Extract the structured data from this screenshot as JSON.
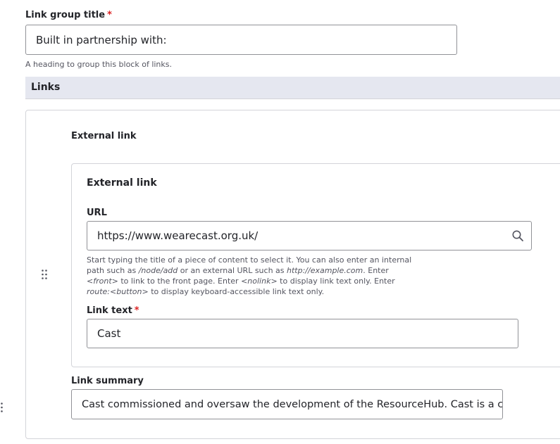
{
  "link_group": {
    "title_label": "Link group title",
    "required_mark": "*",
    "title_value": "Built in partnership with:",
    "title_description": "A heading to group this block of links."
  },
  "links_section": {
    "heading": "Links"
  },
  "external_link": {
    "outer_label": "External link",
    "fieldset_title": "External link",
    "url_label": "URL",
    "url_value": "https://www.wearecast.org.uk/",
    "url_description": {
      "t1": "Start typing the title of a piece of content to select it. You can also enter an internal path such as ",
      "e1": "/node/add",
      "t2": " or an external URL such as ",
      "e2": "http://example.com",
      "t3": ". Enter ",
      "e3": "<front>",
      "t4": " to link to the front page. Enter ",
      "e4": "<nolink>",
      "t5": " to display link text only. Enter ",
      "e5": "route:<button>",
      "t6": " to display keyboard-accessible link text only."
    },
    "link_text_label": "Link text",
    "link_text_value": "Cast"
  },
  "link_summary": {
    "label": "Link summary",
    "value": "Cast commissioned and oversaw the development of the ResourceHub. Cast is a charity or"
  },
  "icons": {
    "drag_handle": "drag-handle-icon",
    "search": "search-icon"
  },
  "colors": {
    "required": "#dc2323",
    "section_bar": "#e5e7f0",
    "border": "#919297"
  }
}
